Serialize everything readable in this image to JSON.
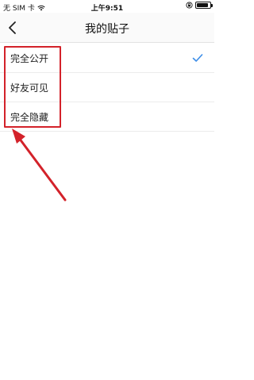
{
  "status_bar": {
    "carrier": "无 SIM 卡",
    "time": "上午9:51",
    "icons": [
      "wifi-icon",
      "orientation-lock-icon",
      "battery-icon"
    ],
    "battery_level": 0.85
  },
  "nav": {
    "back_icon": "chevron-left-icon",
    "title": "我的贴子"
  },
  "options": [
    {
      "label": "完全公开",
      "selected": true
    },
    {
      "label": "好友可见",
      "selected": false
    },
    {
      "label": "完全隐藏",
      "selected": false
    }
  ],
  "colors": {
    "accent": "#3d8ee8",
    "annotation": "#d3222a",
    "divider": "#ececec"
  }
}
